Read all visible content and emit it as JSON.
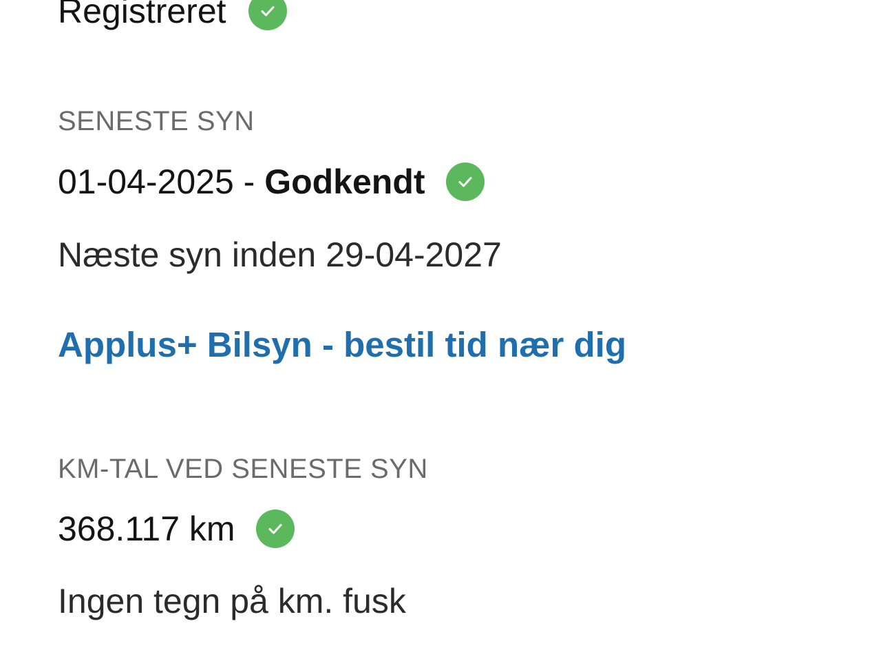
{
  "registration": {
    "status": "Registreret",
    "status_icon": "check-circle-icon"
  },
  "latest_inspection": {
    "label": "SENESTE SYN",
    "date": "01-04-2025",
    "separator": " - ",
    "result": "Godkendt",
    "result_icon": "check-circle-icon",
    "next_inspection": "Næste syn inden 29-04-2027",
    "booking_link": "Applus+ Bilsyn - bestil tid nær dig"
  },
  "mileage": {
    "label": "KM-TAL VED SENESTE SYN",
    "value": "368.117 km",
    "value_icon": "check-circle-icon",
    "note": "Ingen tegn på km. fusk"
  },
  "colors": {
    "success_green": "#5cb85c",
    "link_blue": "#1f6fae",
    "label_gray": "#6b6b6b",
    "text": "#141414"
  }
}
